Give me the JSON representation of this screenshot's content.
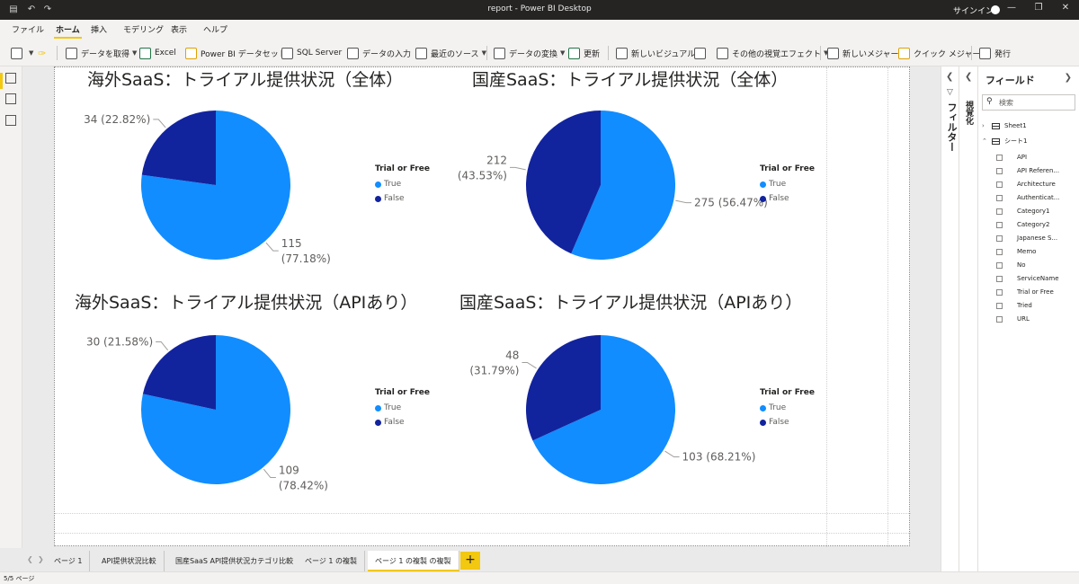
{
  "titlebar": {
    "title": "report - Power BI Desktop",
    "signin": "サインイン",
    "save_icon": "save-icon",
    "undo_icon": "undo-icon",
    "redo_icon": "redo-icon"
  },
  "menu_tabs": [
    "ファイル",
    "ホーム",
    "挿入",
    "モデリング",
    "表示",
    "ヘルプ"
  ],
  "active_tab": "ホーム",
  "ribbon": {
    "get_data": "データを取得",
    "excel": "Excel",
    "pbi_dataset": "Power BI データセット",
    "sql_server": "SQL Server",
    "enter_data": "データの入力",
    "recent_sources": "最近のソース",
    "transform_data": "データの変換",
    "refresh": "更新",
    "new_visual": "新しいビジュアル",
    "more_visuals": "その他の視覚エフェクト",
    "new_measure": "新しいメジャー",
    "quick_measure": "クイック メジャー",
    "publish": "発行"
  },
  "charts": [
    {
      "title": "海外SaaS：トライアル提供状況（全体）",
      "legend_title": "Trial or Free",
      "labels": {
        "true": [
          "115",
          "(77.18%)"
        ],
        "false": [
          "34 (22.82%)"
        ]
      }
    },
    {
      "title": "国産SaaS：トライアル提供状況（全体）",
      "legend_title": "Trial or Free",
      "labels": {
        "true": [
          "275 (56.47%)"
        ],
        "false": [
          "212",
          "(43.53%)"
        ]
      }
    },
    {
      "title": "海外SaaS：トライアル提供状況（APIあり）",
      "legend_title": "Trial or Free",
      "labels": {
        "true": [
          "109",
          "(78.42%)"
        ],
        "false": [
          "30 (21.58%)"
        ]
      }
    },
    {
      "title": "国産SaaS：トライアル提供状況（APIあり）",
      "legend_title": "Trial or Free",
      "labels": {
        "true": [
          "103 (68.21%)"
        ],
        "false": [
          "48",
          "(31.79%)"
        ]
      }
    }
  ],
  "legend_items": [
    "True",
    "False"
  ],
  "colors": {
    "true": "#118dff",
    "false": "#12239e",
    "accent": "#f2c811"
  },
  "chart_data": [
    {
      "type": "pie",
      "title": "海外SaaS：トライアル提供状況（全体）",
      "legend_title": "Trial or Free",
      "categories": [
        "True",
        "False"
      ],
      "values": [
        115,
        34
      ],
      "percentages": [
        77.18,
        22.82
      ]
    },
    {
      "type": "pie",
      "title": "国産SaaS：トライアル提供状況（全体）",
      "legend_title": "Trial or Free",
      "categories": [
        "True",
        "False"
      ],
      "values": [
        275,
        212
      ],
      "percentages": [
        56.47,
        43.53
      ]
    },
    {
      "type": "pie",
      "title": "海外SaaS：トライアル提供状況（APIあり）",
      "legend_title": "Trial or Free",
      "categories": [
        "True",
        "False"
      ],
      "values": [
        109,
        30
      ],
      "percentages": [
        78.42,
        21.58
      ]
    },
    {
      "type": "pie",
      "title": "国産SaaS：トライアル提供状況（APIあり）",
      "legend_title": "Trial or Free",
      "categories": [
        "True",
        "False"
      ],
      "values": [
        103,
        48
      ],
      "percentages": [
        68.21,
        31.79
      ]
    }
  ],
  "filters_pane": {
    "label": "フィルター"
  },
  "viz_pane": {
    "label": "視覚化"
  },
  "fields_pane": {
    "title": "フィールド",
    "search_placeholder": "検索",
    "tables": [
      "Sheet1",
      "シート1"
    ],
    "fields": [
      "API",
      "API Referen...",
      "Architecture",
      "Authenticat...",
      "Category1",
      "Category2",
      "Japanese S...",
      "Memo",
      "No",
      "ServiceName",
      "Trial or Free",
      "Tried",
      "URL"
    ]
  },
  "page_tabs": [
    "ページ 1",
    "API提供状況比較",
    "国産SaaS API提供状況カテゴリ比較",
    "ページ 1 の複製",
    "ページ 1 の複製 の複製"
  ],
  "active_page": "ページ 1 の複製 の複製",
  "status": "5/5 ページ"
}
